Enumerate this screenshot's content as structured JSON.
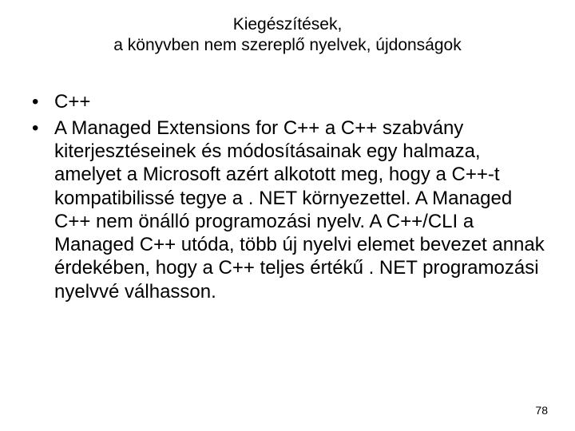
{
  "title": {
    "line1": "Kiegészítések,",
    "line2": "a könyvben nem szereplő nyelvek, újdonságok"
  },
  "bullets": [
    "C++",
    "A Managed Extensions for C++ a C++ szabvány kiterjesztéseinek és módosításainak egy halmaza, amelyet a Microsoft azért alkotott meg, hogy a C++-t kompatibilissé tegye a . NET környezettel. A Managed C++ nem önálló programozási nyelv. A C++/CLI a Managed C++ utóda, több új nyelvi elemet bevezet annak érdekében, hogy a C++ teljes értékű . NET programozási nyelvvé válhasson."
  ],
  "bullet_marker": "•",
  "page_number": "78"
}
